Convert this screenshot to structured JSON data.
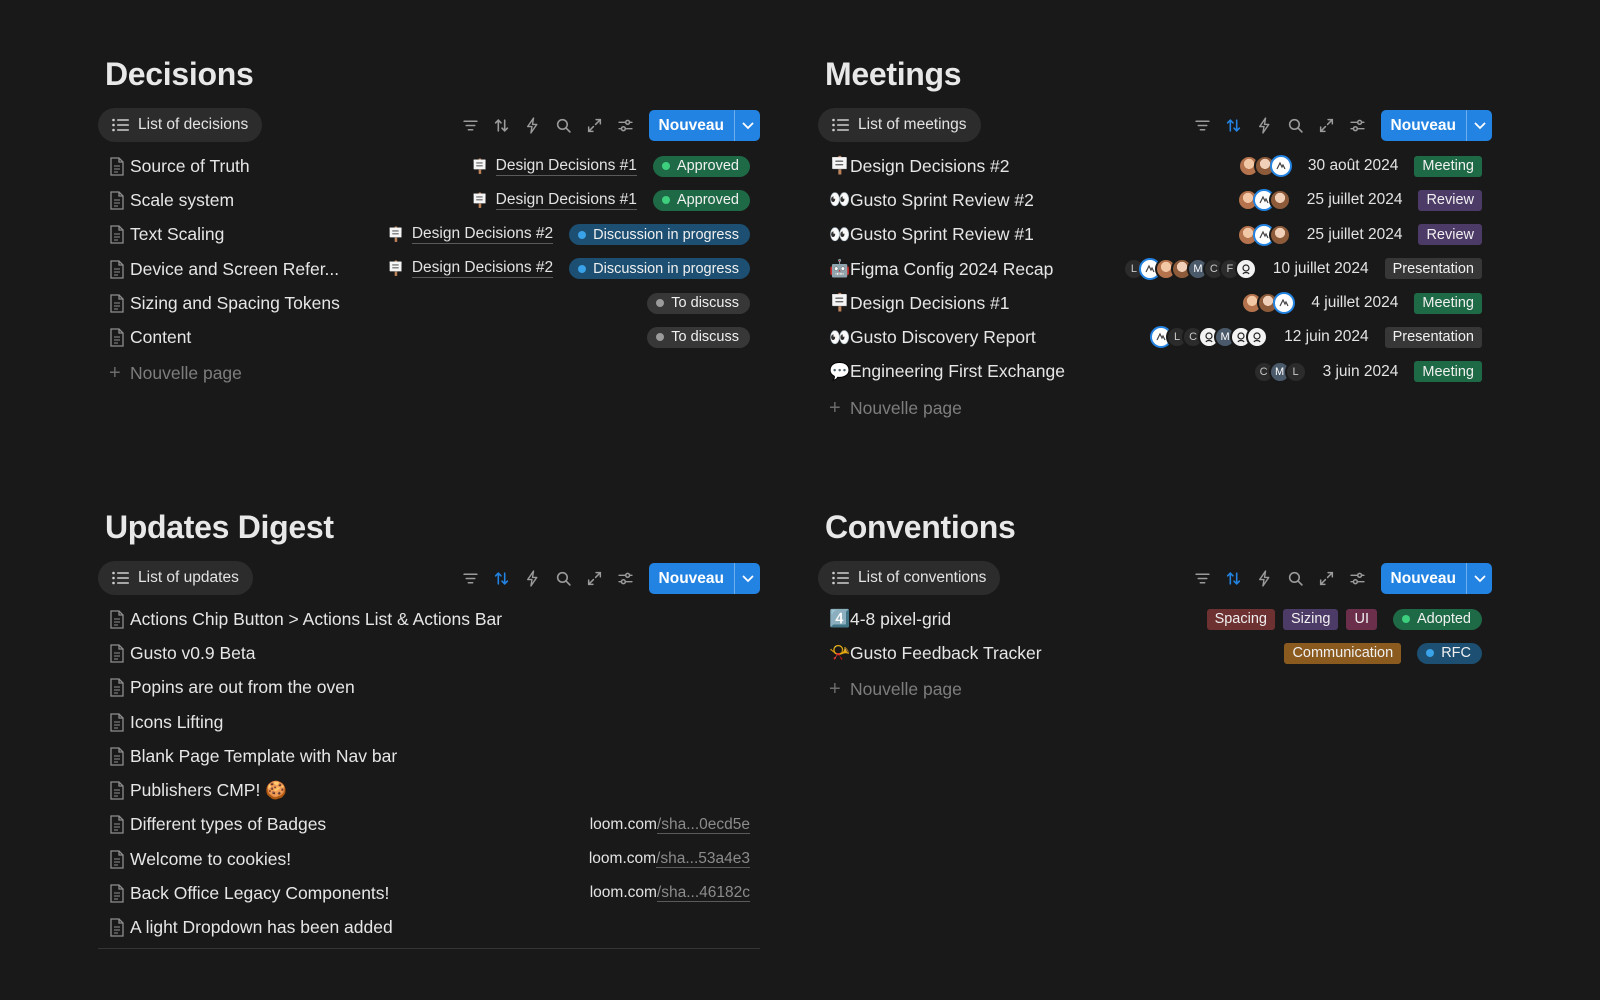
{
  "decisions": {
    "title": "Decisions",
    "view_label": "List of decisions",
    "new_label": "Nouveau",
    "rows": [
      {
        "title": "Source of Truth",
        "relation": "Design Decisions #1",
        "status": "Approved"
      },
      {
        "title": "Scale system",
        "relation": "Design Decisions #1",
        "status": "Approved"
      },
      {
        "title": "Text Scaling",
        "relation": "Design Decisions #2",
        "status": "Discussion in progress"
      },
      {
        "title": "Device and Screen Refer...",
        "relation": "Design Decisions #2",
        "status": "Discussion in progress"
      },
      {
        "title": "Sizing and Spacing Tokens",
        "relation": "",
        "status": "To discuss"
      },
      {
        "title": "Content",
        "relation": "",
        "status": "To discuss"
      }
    ],
    "new_page_label": "Nouvelle page"
  },
  "meetings": {
    "title": "Meetings",
    "view_label": "List of meetings",
    "new_label": "Nouveau",
    "rows": [
      {
        "emoji": "🪧",
        "title": "Design Decisions #2",
        "date": "30 août 2024",
        "type": "Meeting",
        "avatars": [
          "photo",
          "photo2",
          "blue"
        ]
      },
      {
        "emoji": "👀",
        "title": "Gusto Sprint Review #2",
        "date": "25 juillet 2024",
        "type": "Review",
        "avatars": [
          "photo",
          "blue",
          "photo2"
        ]
      },
      {
        "emoji": "👀",
        "title": "Gusto Sprint Review #1",
        "date": "25 juillet 2024",
        "type": "Review",
        "avatars": [
          "photo",
          "blue",
          "photo2"
        ]
      },
      {
        "emoji": "🤖",
        "title": "Figma Config 2024 Recap",
        "date": "10 juillet 2024",
        "type": "Presentation",
        "avatars": [
          "L",
          "blue",
          "photo",
          "photo2",
          "M",
          "C",
          "F",
          "draw"
        ]
      },
      {
        "emoji": "🪧",
        "title": "Design Decisions #1",
        "date": "4 juillet 2024",
        "type": "Meeting",
        "avatars": [
          "photo",
          "photo2",
          "blue"
        ]
      },
      {
        "emoji": "👀",
        "title": "Gusto Discovery Report",
        "date": "12 juin 2024",
        "type": "Presentation",
        "avatars": [
          "blue",
          "L",
          "C",
          "draw",
          "M",
          "draw",
          "draw"
        ]
      },
      {
        "emoji": "💬",
        "title": "Engineering First Exchange",
        "date": "3 juin 2024",
        "type": "Meeting",
        "avatars": [
          "C",
          "M",
          "L"
        ]
      }
    ],
    "new_page_label": "Nouvelle page"
  },
  "updates": {
    "title": "Updates Digest",
    "view_label": "List of updates",
    "new_label": "Nouveau",
    "rows": [
      {
        "title": "Actions Chip Button > Actions List & Actions Bar",
        "link_host": "",
        "link_path": ""
      },
      {
        "title": "Gusto v0.9 Beta",
        "link_host": "",
        "link_path": ""
      },
      {
        "title": "Popins are out from the oven",
        "link_host": "",
        "link_path": ""
      },
      {
        "title": "Icons Lifting",
        "link_host": "",
        "link_path": ""
      },
      {
        "title": "Blank Page Template with Nav bar",
        "link_host": "",
        "link_path": ""
      },
      {
        "title": "Publishers CMP! 🍪",
        "link_host": "",
        "link_path": ""
      },
      {
        "title": "Different types of Badges",
        "link_host": "loom.com",
        "link_path": "/sha...0ecd5e"
      },
      {
        "title": "Welcome to cookies!",
        "link_host": "loom.com",
        "link_path": "/sha...53a4e3"
      },
      {
        "title": "Back Office Legacy Components!",
        "link_host": "loom.com",
        "link_path": "/sha...46182c"
      },
      {
        "title": "A light Dropdown has been added",
        "link_host": "",
        "link_path": ""
      }
    ]
  },
  "conventions": {
    "title": "Conventions",
    "view_label": "List of conventions",
    "new_label": "Nouveau",
    "rows": [
      {
        "emoji": "4️⃣",
        "title": "4-8 pixel-grid",
        "tags": [
          "Spacing",
          "Sizing",
          "UI"
        ],
        "status": "Adopted"
      },
      {
        "emoji": "📯",
        "title": "Gusto Feedback Tracker",
        "tags": [
          "Communication"
        ],
        "status": "RFC"
      }
    ],
    "new_page_label": "Nouvelle page"
  },
  "colors": {
    "background": "#191919",
    "accent": "#2383e2",
    "approved": "#1f6a46",
    "discussion": "#1c4f72",
    "todiscuss": "#373737",
    "meeting": "#1f6a46",
    "review": "#4c3a67",
    "presentation": "#373737",
    "spacing": "#6e3131",
    "sizing": "#4c3a67",
    "ui": "#6b2f4c",
    "communication": "#8a5a1f",
    "rfc": "#1c4f72"
  },
  "icons": [
    "list-icon",
    "filter-icon",
    "sort-icon",
    "lightning-icon",
    "search-icon",
    "expand-icon",
    "settings-icon",
    "chevron-down-icon",
    "page-icon",
    "plus-icon"
  ]
}
